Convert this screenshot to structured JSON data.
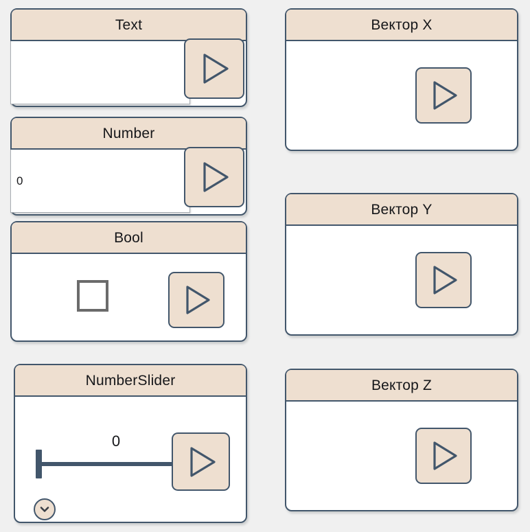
{
  "canvas": {
    "background_color": "#f0f0f0",
    "panel_border_color": "#42566b",
    "panel_header_color": "#eedfd0",
    "panel_body_color": "#ffffff",
    "accent_color": "#eedfd0"
  },
  "panels": {
    "text": {
      "title": "Text",
      "input_value": "",
      "input_placeholder": "",
      "run_icon": "play-icon"
    },
    "number": {
      "title": "Number",
      "input_value": "0",
      "input_placeholder": "",
      "run_icon": "play-icon"
    },
    "bool": {
      "title": "Bool",
      "checkbox_checked": false,
      "checkbox_icon": "checkbox-unchecked-icon",
      "run_icon": "play-icon"
    },
    "number_slider": {
      "title": "NumberSlider",
      "value": "0",
      "slider_position_percent": 0,
      "expand_icon": "chevron-down-icon",
      "run_icon": "play-icon"
    },
    "vector_x": {
      "title": "Вектор X",
      "run_icon": "play-icon"
    },
    "vector_y": {
      "title": "Вектор Y",
      "run_icon": "play-icon"
    },
    "vector_z": {
      "title": "Вектор Z",
      "run_icon": "play-icon"
    }
  }
}
